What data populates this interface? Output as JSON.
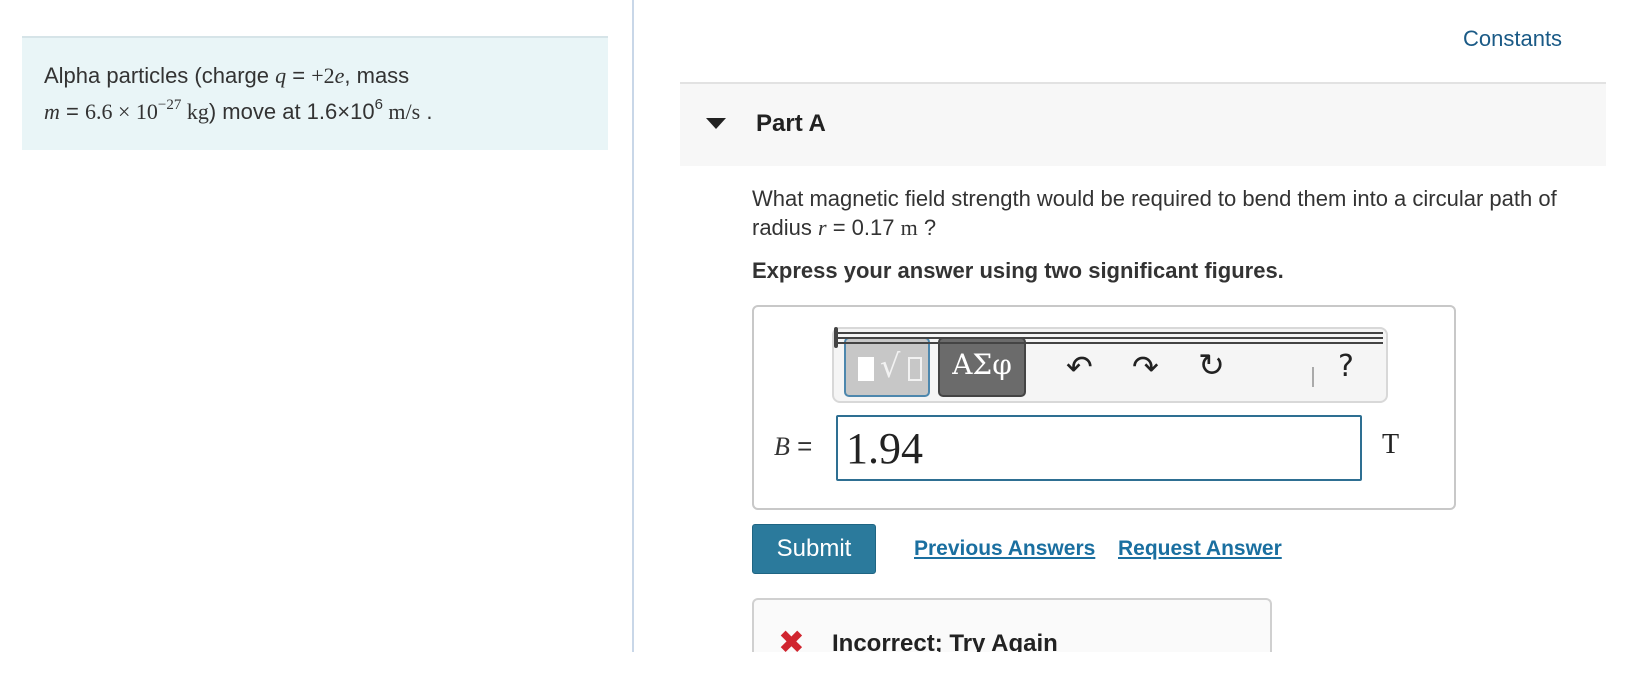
{
  "problem": {
    "line1_prefix": "Alpha particles (charge ",
    "q_symbol": "q",
    "eq1": " = ",
    "q_value": "+2",
    "e_symbol": "e",
    "line1_suffix": ", mass",
    "m_symbol": "m",
    "eq2": " = ",
    "m_value": "6.6 × 10",
    "m_exp": "−27",
    "m_unit": " kg",
    "line2_mid": ") move at 1.6×10",
    "v_exp": "6",
    "v_unit": " m/s",
    "line2_end": " ."
  },
  "header": {
    "constants_link": "Constants"
  },
  "part": {
    "title": "Part A"
  },
  "question": {
    "text_before": "What magnetic field strength would be required to bend them into a circular path of radius ",
    "r_symbol": "r",
    "text_eq": " = 0.17 ",
    "r_unit": " m",
    "text_after": " ?",
    "instruction": "Express your answer using two significant figures."
  },
  "toolbar": {
    "templates_icon": "templates-icon",
    "templates_radical": "√",
    "symbols_label": "ΑΣφ",
    "undo_glyph": "↶",
    "redo_glyph": "↷",
    "reset_glyph": "↻",
    "help_label": "?"
  },
  "answer": {
    "variable": "B",
    "equals": " =",
    "value": "1.94",
    "unit": "T"
  },
  "actions": {
    "submit_label": "Submit",
    "previous_answers_label": "Previous Answers",
    "request_answer_label": "Request Answer"
  },
  "feedback": {
    "icon_glyph": "✖",
    "message": "Incorrect; Try Again"
  },
  "colors": {
    "accent": "#2b7a9c",
    "link": "#1a6fa0",
    "error": "#d0252f",
    "problem_bg": "#e9f5f7"
  }
}
